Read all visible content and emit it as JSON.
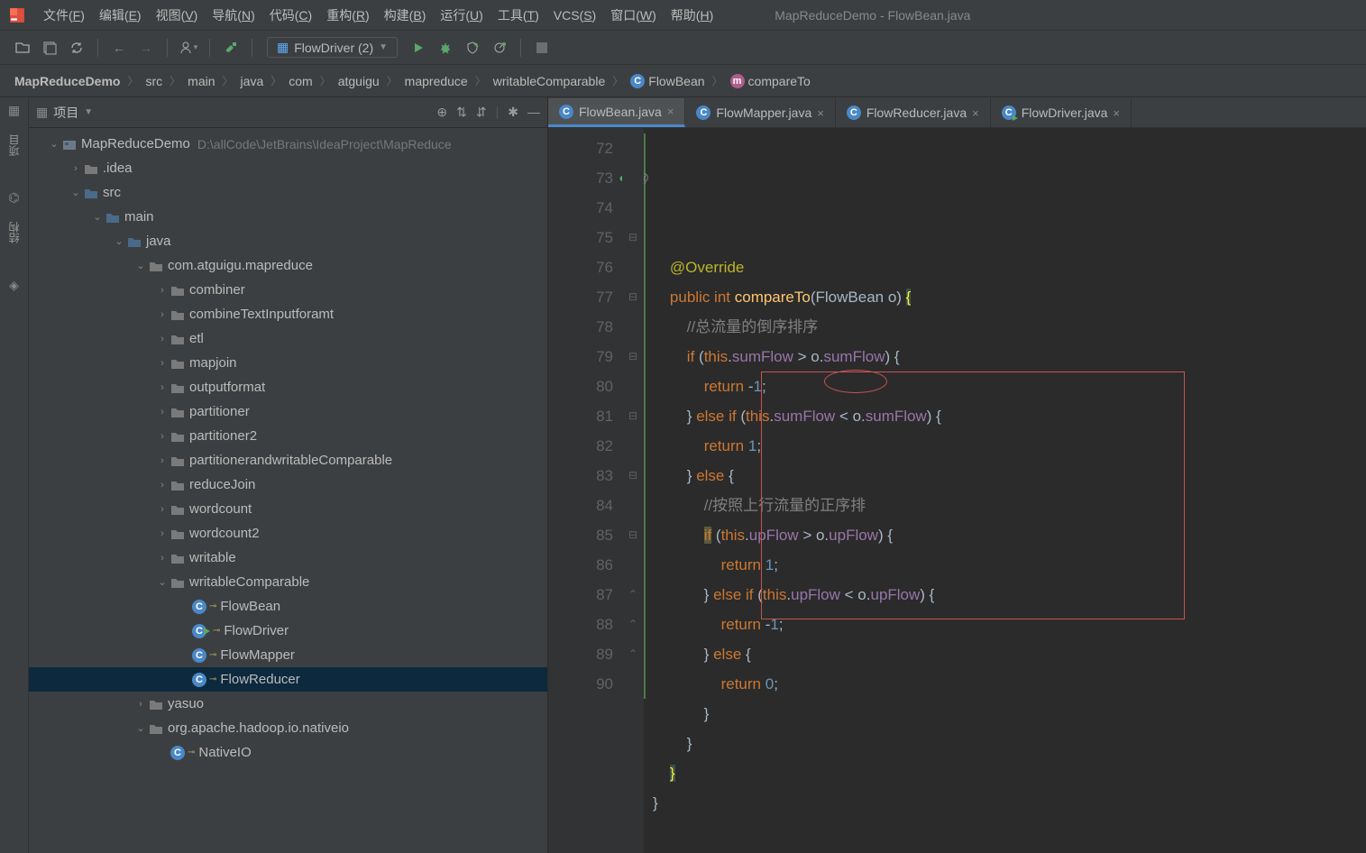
{
  "app": {
    "title_project": "MapReduceDemo",
    "title_sep": " - ",
    "title_file": "FlowBean.java"
  },
  "menu": [
    "文件(F)",
    "编辑(E)",
    "视图(V)",
    "导航(N)",
    "代码(C)",
    "重构(R)",
    "构建(B)",
    "运行(U)",
    "工具(T)",
    "VCS(S)",
    "窗口(W)",
    "帮助(H)"
  ],
  "runconfig": {
    "label": "FlowDriver (2)"
  },
  "breadcrumbs": [
    {
      "label": "MapReduceDemo",
      "bold": true
    },
    {
      "label": "src"
    },
    {
      "label": "main"
    },
    {
      "label": "java"
    },
    {
      "label": "com"
    },
    {
      "label": "atguigu"
    },
    {
      "label": "mapreduce"
    },
    {
      "label": "writableComparable"
    },
    {
      "label": "FlowBean",
      "icon": "c"
    },
    {
      "label": "compareTo",
      "icon": "m"
    }
  ],
  "leftStrip": {
    "project": "项目",
    "structure": "结构"
  },
  "panel": {
    "title": "项目"
  },
  "tree": [
    {
      "d": 0,
      "a": "v",
      "ico": "mod",
      "label": "MapReduceDemo",
      "hint": "D:\\allCode\\JetBrains\\IdeaProject\\MapReduce"
    },
    {
      "d": 1,
      "a": ">",
      "ico": "fg",
      "label": ".idea"
    },
    {
      "d": 1,
      "a": "v",
      "ico": "fb",
      "label": "src"
    },
    {
      "d": 2,
      "a": "v",
      "ico": "fb",
      "label": "main"
    },
    {
      "d": 3,
      "a": "v",
      "ico": "fb",
      "label": "java"
    },
    {
      "d": 4,
      "a": "v",
      "ico": "fg",
      "label": "com.atguigu.mapreduce"
    },
    {
      "d": 5,
      "a": ">",
      "ico": "fg",
      "label": "combiner"
    },
    {
      "d": 5,
      "a": ">",
      "ico": "fg",
      "label": "combineTextInputforamt"
    },
    {
      "d": 5,
      "a": ">",
      "ico": "fg",
      "label": "etl"
    },
    {
      "d": 5,
      "a": ">",
      "ico": "fg",
      "label": "mapjoin"
    },
    {
      "d": 5,
      "a": ">",
      "ico": "fg",
      "label": "outputformat"
    },
    {
      "d": 5,
      "a": ">",
      "ico": "fg",
      "label": "partitioner"
    },
    {
      "d": 5,
      "a": ">",
      "ico": "fg",
      "label": "partitioner2"
    },
    {
      "d": 5,
      "a": ">",
      "ico": "fg",
      "label": "partitionerandwritableComparable"
    },
    {
      "d": 5,
      "a": ">",
      "ico": "fg",
      "label": "reduceJoin"
    },
    {
      "d": 5,
      "a": ">",
      "ico": "fg",
      "label": "wordcount"
    },
    {
      "d": 5,
      "a": ">",
      "ico": "fg",
      "label": "wordcount2"
    },
    {
      "d": 5,
      "a": ">",
      "ico": "fg",
      "label": "writable"
    },
    {
      "d": 5,
      "a": "v",
      "ico": "fg",
      "label": "writableComparable"
    },
    {
      "d": 6,
      "a": " ",
      "ico": "c",
      "label": "FlowBean",
      "lock": true
    },
    {
      "d": 6,
      "a": " ",
      "ico": "c",
      "label": "FlowDriver",
      "lock": true,
      "run": true
    },
    {
      "d": 6,
      "a": " ",
      "ico": "c",
      "label": "FlowMapper",
      "lock": true
    },
    {
      "d": 6,
      "a": " ",
      "ico": "c",
      "label": "FlowReducer",
      "lock": true,
      "selected": true
    },
    {
      "d": 4,
      "a": ">",
      "ico": "fg",
      "label": "yasuo"
    },
    {
      "d": 4,
      "a": "v",
      "ico": "fg",
      "label": "org.apache.hadoop.io.nativeio"
    },
    {
      "d": 5,
      "a": " ",
      "ico": "c",
      "label": "NativeIO",
      "lock": true
    }
  ],
  "tabs": [
    {
      "label": "FlowBean.java",
      "active": true
    },
    {
      "label": "FlowMapper.java"
    },
    {
      "label": "FlowReducer.java"
    },
    {
      "label": "FlowDriver.java",
      "run": true
    }
  ],
  "code": {
    "start": 72,
    "lines": [
      {
        "n": 72,
        "html": "    <span class='ann'>@Override</span>"
      },
      {
        "n": 73,
        "html": "    <span class='kw'>public int </span><span class='mtd'>compareTo</span>(FlowBean o) <span class='hl-brace'>{</span>",
        "annot": "@",
        "green": true
      },
      {
        "n": 74,
        "html": "        <span class='cmt'>//总流量的倒序排序</span>"
      },
      {
        "n": 75,
        "html": "        <span class='kw'>if</span> (<span class='kw'>this</span>.<span class='fld'>sumFlow</span> > o.<span class='fld'>sumFlow</span>) {",
        "fold": "-"
      },
      {
        "n": 76,
        "html": "            <span class='kw'>return</span> -<span class='num'>1</span>;"
      },
      {
        "n": 77,
        "html": "        } <span class='kw'>else if</span> (<span class='kw'>this</span>.<span class='fld'>sumFlow</span> < o.<span class='fld'>sumFlow</span>) {",
        "fold": "-"
      },
      {
        "n": 78,
        "html": "            <span class='kw'>return</span> <span class='num'>1</span>;"
      },
      {
        "n": 79,
        "html": "        } <span class='kw'>else</span> {",
        "fold": "-"
      },
      {
        "n": 80,
        "html": "            <span class='cmt'>//按照上行流量的正序排</span>"
      },
      {
        "n": 81,
        "html": "            <span style='background:#5b5b3b'><span class='kw'>if</span></span> (<span class='kw'>this</span>.<span class='fld'>upFlow</span> > o.<span class='fld'>upFlow</span>) {",
        "fold": "-"
      },
      {
        "n": 82,
        "html": "                <span class='kw'>return</span> <span class='num'>1</span>;"
      },
      {
        "n": 83,
        "html": "            } <span class='kw'>else if</span> (<span class='kw'>this</span>.<span class='fld'>upFlow</span> < o.<span class='fld'>upFlow</span>) {",
        "fold": "-"
      },
      {
        "n": 84,
        "html": "                <span class='kw'>return</span> -<span class='num'>1</span>;"
      },
      {
        "n": 85,
        "html": "            } <span class='kw'>else</span> {",
        "fold": "-"
      },
      {
        "n": 86,
        "html": "                <span class='kw'>return</span> <span class='num'>0</span>;"
      },
      {
        "n": 87,
        "html": "            }",
        "fold": "^"
      },
      {
        "n": 88,
        "html": "        }",
        "fold": "^"
      },
      {
        "n": 89,
        "html": "    <span class='hl-brace'>}</span>",
        "fold": "^"
      },
      {
        "n": 90,
        "html": "}"
      }
    ]
  }
}
